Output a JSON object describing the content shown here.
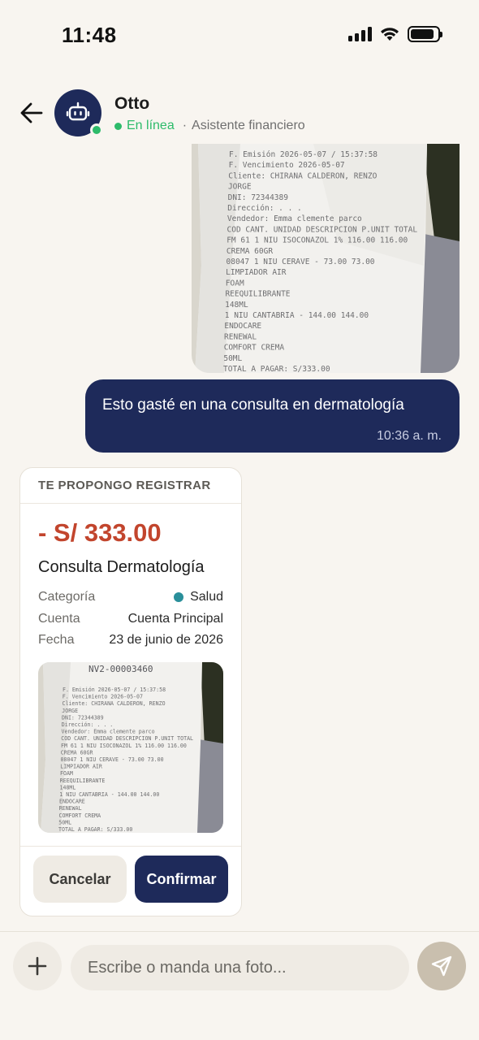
{
  "status_bar": {
    "time": "11:48"
  },
  "header": {
    "contact_name": "Otto",
    "status": "En línea",
    "separator": "·",
    "role": "Asistente financiero"
  },
  "messages": {
    "receipt_photo": {
      "lines": [
        "F. Emisión   2026-05-07 / 15:37:58",
        "F. Vencimiento 2026-05-07",
        "Cliente:     CHIRANA CALDERON, RENZO",
        "             JORGE",
        "DNI:         72344389",
        "Dirección:   . . .",
        "Vendedor:    Emma clemente parco",
        "COD  CANT. UNIDAD DESCRIPCION  P.UNIT TOTAL",
        "FM 61  1  NIU ISOCONAZOL 1%  116.00 116.00",
        "              CREMA 60GR",
        "08047  1  NIU CERAVE -        73.00  73.00",
        "              LIMPIADOR AIR",
        "              FOAM",
        "              REEQUILIBRANTE",
        "              148ML",
        "       1  NIU CANTABRIA -   144.00 144.00",
        "              ENDOCARE",
        "              RENEWAL",
        "              COMFORT CREMA",
        "              50ML",
        "              TOTAL A PAGAR: S/333.00"
      ]
    },
    "outgoing": {
      "text": "Esto gasté en una consulta en dermatología",
      "time": "10:36 a. m."
    }
  },
  "proposal": {
    "header": "TE PROPONGO REGISTRAR",
    "amount": "- S/ 333.00",
    "title": "Consulta Dermatología",
    "rows": [
      {
        "label": "Categoría",
        "value": "Salud",
        "dot_color": "#2a8f9a"
      },
      {
        "label": "Cuenta",
        "value": "Cuenta Principal"
      },
      {
        "label": "Fecha",
        "value": "23 de junio de 2026"
      }
    ],
    "photo_header": "NV2-00003460",
    "cancel_label": "Cancelar",
    "confirm_label": "Confirmar"
  },
  "composer": {
    "placeholder": "Escribe o manda una foto..."
  },
  "colors": {
    "navy": "#1e2a5a",
    "online": "#2dbb6a",
    "amount": "#c2452d",
    "category": "#2a8f9a",
    "background": "#f8f5f0"
  },
  "icons": [
    "back-arrow-icon",
    "robot-icon",
    "plus-icon",
    "send-icon"
  ]
}
